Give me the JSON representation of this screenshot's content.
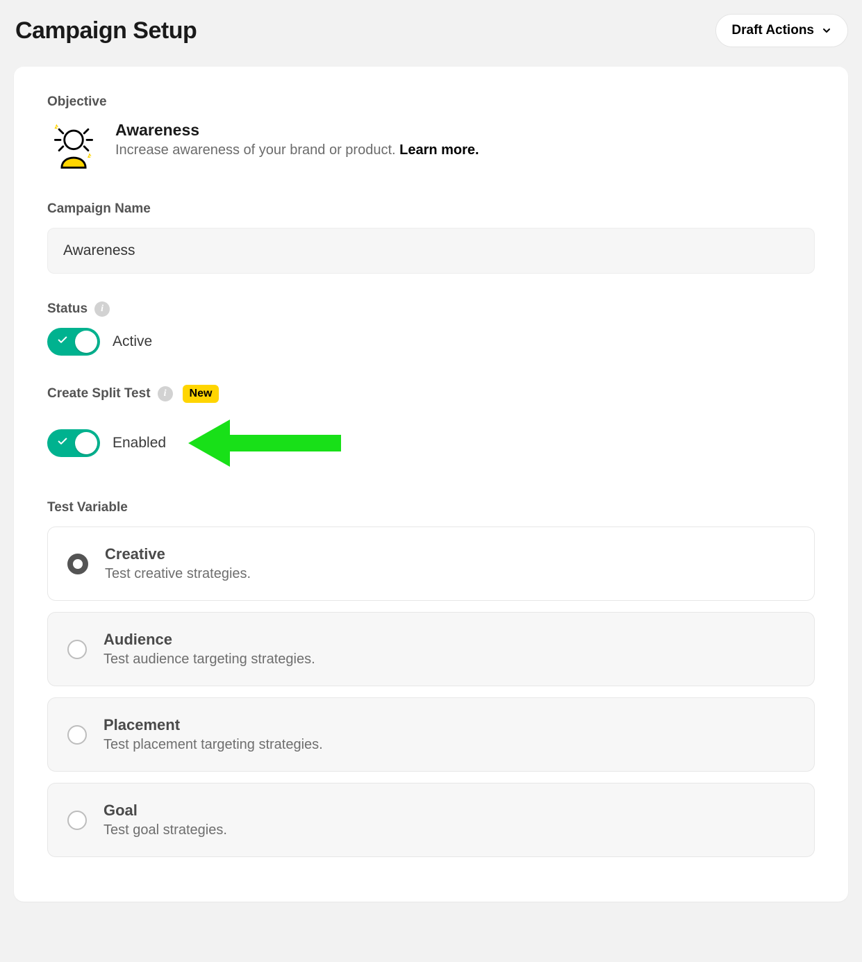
{
  "header": {
    "title": "Campaign Setup",
    "draft_actions": "Draft Actions"
  },
  "objective": {
    "label": "Objective",
    "title": "Awareness",
    "description": "Increase awareness of your brand or product.",
    "learn_more": "Learn more."
  },
  "campaign_name": {
    "label": "Campaign Name",
    "value": "Awareness"
  },
  "status": {
    "label": "Status",
    "value_label": "Active"
  },
  "split_test": {
    "label": "Create Split Test",
    "badge": "New",
    "value_label": "Enabled"
  },
  "test_variable": {
    "label": "Test Variable",
    "options": [
      {
        "title": "Creative",
        "desc": "Test creative strategies.",
        "selected": true
      },
      {
        "title": "Audience",
        "desc": "Test audience targeting strategies.",
        "selected": false
      },
      {
        "title": "Placement",
        "desc": "Test placement targeting strategies.",
        "selected": false
      },
      {
        "title": "Goal",
        "desc": "Test goal strategies.",
        "selected": false
      }
    ]
  }
}
